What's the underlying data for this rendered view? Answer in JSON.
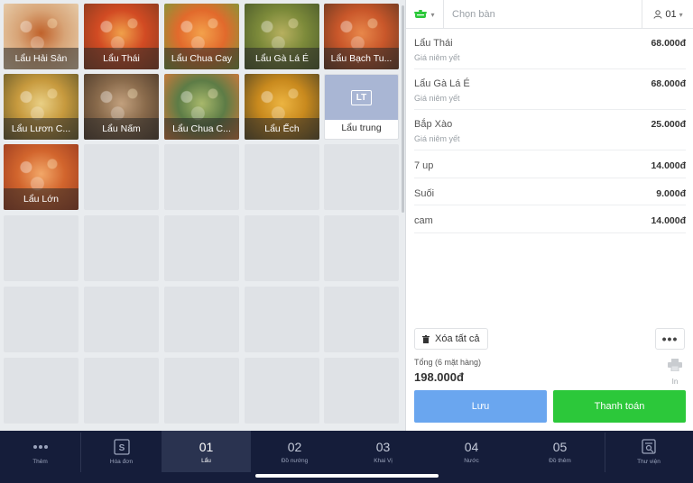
{
  "menu_items": [
    {
      "label": "Lẩu Hải Sản",
      "type": "photo",
      "colors": [
        "#d8a578",
        "#c0622b",
        "#e8d1b0"
      ]
    },
    {
      "label": "Lẩu Thái",
      "type": "photo",
      "colors": [
        "#d24b23",
        "#f0a04a",
        "#8a3b1f"
      ]
    },
    {
      "label": "Lẩu Chua Cay",
      "type": "photo",
      "colors": [
        "#e26a2c",
        "#f3a14b",
        "#7d9a3a"
      ]
    },
    {
      "label": "Lẩu Gà Lá É",
      "type": "photo",
      "colors": [
        "#7c8a3a",
        "#b7b05f",
        "#4b5a2b"
      ]
    },
    {
      "label": "Lẩu Bạch Tu...",
      "type": "photo",
      "colors": [
        "#c9572a",
        "#e8874a",
        "#6d3a22"
      ]
    },
    {
      "label": "Lẩu Lươn C...",
      "type": "photo",
      "colors": [
        "#c79a3e",
        "#e9cf84",
        "#6b5d2b"
      ]
    },
    {
      "label": "Lẩu Nấm",
      "type": "photo",
      "colors": [
        "#8a6b4c",
        "#c2a07d",
        "#4e3b2b"
      ]
    },
    {
      "label": "Lẩu Chua C...",
      "type": "photo",
      "colors": [
        "#5d7c46",
        "#a8b86b",
        "#d97a3b"
      ]
    },
    {
      "label": "Lẩu Ếch",
      "type": "photo",
      "colors": [
        "#c98a1e",
        "#ecb441",
        "#5b4b23"
      ]
    },
    {
      "label": "Lẩu trung",
      "type": "abbr",
      "abbr": "LT"
    },
    {
      "label": "Lẩu Lớn",
      "type": "photo",
      "colors": [
        "#d2652d",
        "#f2a768",
        "#9c3c20"
      ]
    }
  ],
  "header": {
    "area_icon": "pot-icon",
    "table_placeholder": "Chọn bàn",
    "guest_count": "01"
  },
  "order_items": [
    {
      "name": "Lẩu Thái",
      "note": "Giá niêm yết",
      "price": "68.000đ"
    },
    {
      "name": "Lẩu Gà Lá É",
      "note": "Giá niêm yết",
      "price": "68.000đ"
    },
    {
      "name": "Bắp Xào",
      "note": "Giá niêm yết",
      "price": "25.000đ"
    },
    {
      "name": "7 up",
      "note": "",
      "price": "14.000đ"
    },
    {
      "name": "Suối",
      "note": "",
      "price": "9.000đ"
    },
    {
      "name": "cam",
      "note": "",
      "price": "14.000đ"
    }
  ],
  "actions": {
    "clear_all": "Xóa tất cả",
    "more": "•••",
    "total_label": "Tổng (6 mặt hàng)",
    "total_value": "198.000đ",
    "print_label": "In",
    "save": "Lưu",
    "pay": "Thanh toán"
  },
  "bottom_nav": [
    {
      "label": "Thêm",
      "icon": "more-dots-icon"
    },
    {
      "label": "Hóa đơn",
      "icon": "invoice-icon"
    },
    {
      "label": "Lẩu",
      "number": "01",
      "active": true
    },
    {
      "label": "Đồ nướng",
      "number": "02"
    },
    {
      "label": "Khai Vị",
      "number": "03"
    },
    {
      "label": "Nước",
      "number": "04"
    },
    {
      "label": "Đồ thêm",
      "number": "05"
    },
    {
      "label": "Thư viện",
      "icon": "library-icon"
    }
  ],
  "colors": {
    "accent_green": "#2cc83a",
    "save_blue": "#6aa6ef",
    "nav_bg": "#151d3a",
    "nav_active": "#2a3350"
  }
}
